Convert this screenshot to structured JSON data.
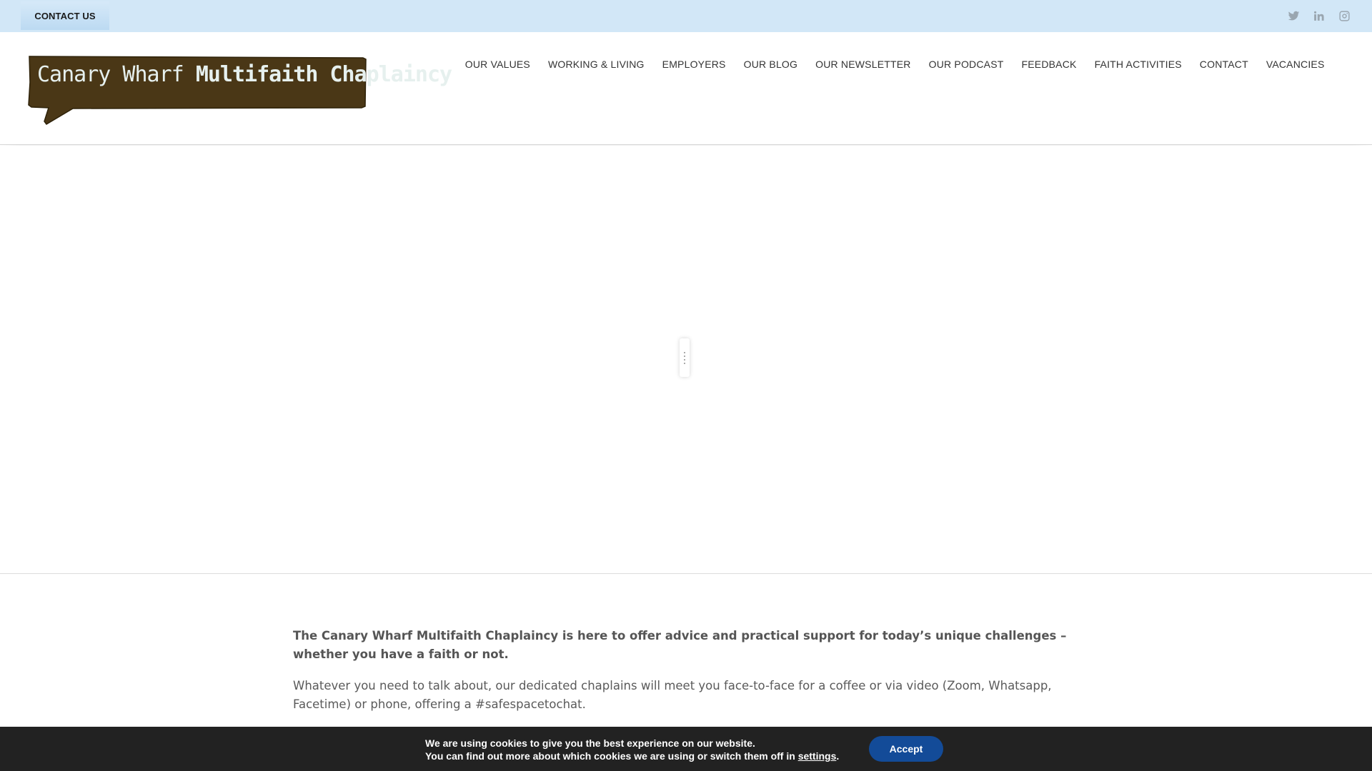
{
  "topbar": {
    "contact_label": "CONTACT US",
    "social": [
      "twitter-icon",
      "linkedin-icon",
      "instagram-icon"
    ]
  },
  "header": {
    "logo_text_part1": "Canary Wharf ",
    "logo_text_part2": "Multifaith Chaplaincy",
    "nav": [
      "OUR VALUES",
      "WORKING & LIVING",
      "EMPLOYERS",
      "OUR BLOG",
      "OUR NEWSLETTER",
      "OUR PODCAST",
      "FEEDBACK",
      "FAITH ACTIVITIES",
      "CONTACT",
      "VACANCIES"
    ]
  },
  "content": {
    "intro": "The Canary Wharf Multifaith Chaplaincy is  here to offer advice and practical support for today’s unique challenges – whether you have a faith or not.",
    "body": "Whatever you need to talk about, our dedicated chaplains will meet you face-to-face for a coffee or via video (Zoom, Whatsapp, Facetime) or phone, offering a #safespacetochat."
  },
  "cookie": {
    "line1": "We are using cookies to give you the best experience on our website.",
    "line2_prefix": "You can find out more about which cookies we are using or switch them off in ",
    "settings_label": "settings",
    "line2_suffix": ".",
    "accept_label": "Accept"
  },
  "colors": {
    "topbar_bg": "#d2e7f7",
    "logo_brown": "#4a3716",
    "cookie_bg": "#222222",
    "accept_bg": "#134b98"
  }
}
